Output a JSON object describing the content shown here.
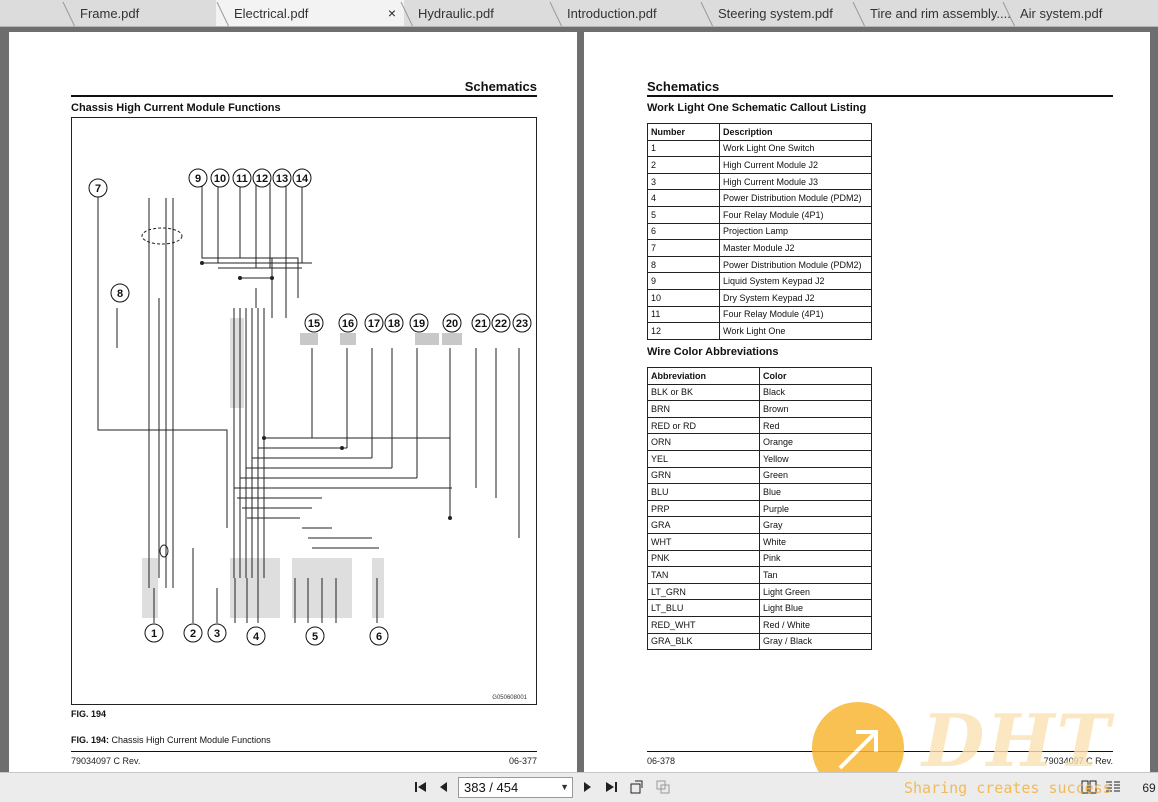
{
  "tabs": [
    {
      "label": "Frame.pdf",
      "active": false
    },
    {
      "label": "Electrical.pdf",
      "active": true,
      "close": "×"
    },
    {
      "label": "Hydraulic.pdf",
      "active": false
    },
    {
      "label": "Introduction.pdf",
      "active": false
    },
    {
      "label": "Steering system.pdf",
      "active": false
    },
    {
      "label": "Tire and rim assembly....",
      "active": false
    },
    {
      "label": "Air system.pdf",
      "active": false
    }
  ],
  "left_page": {
    "section": "Schematics",
    "subtitle": "Chassis High Current Module Functions",
    "fig_label": "FIG. 194",
    "caption_prefix": "FIG. 194:",
    "caption_text": "Chassis High Current Module Functions",
    "drawing_id": "G050608001",
    "footer_left": "79034097 C Rev.",
    "footer_right": "06-377",
    "callouts": [
      "1",
      "2",
      "3",
      "4",
      "5",
      "6",
      "7",
      "8",
      "9",
      "10",
      "11",
      "12",
      "13",
      "14",
      "15",
      "16",
      "17",
      "18",
      "19",
      "20",
      "21",
      "22",
      "23"
    ]
  },
  "right_page": {
    "section": "Schematics",
    "callout_title": "Work Light One Schematic Callout Listing",
    "callout_headers": [
      "Number",
      "Description"
    ],
    "callout_rows": [
      [
        "1",
        "Work Light One Switch"
      ],
      [
        "2",
        "High Current Module J2"
      ],
      [
        "3",
        "High Current Module J3"
      ],
      [
        "4",
        "Power Distribution Module (PDM2)"
      ],
      [
        "5",
        "Four Relay Module (4P1)"
      ],
      [
        "6",
        "Projection Lamp"
      ],
      [
        "7",
        "Master Module J2"
      ],
      [
        "8",
        "Power Distribution Module (PDM2)"
      ],
      [
        "9",
        "Liquid System Keypad J2"
      ],
      [
        "10",
        "Dry System Keypad J2"
      ],
      [
        "11",
        "Four Relay Module (4P1)"
      ],
      [
        "12",
        "Work Light One"
      ]
    ],
    "wire_title": "Wire Color Abbreviations",
    "wire_headers": [
      "Abbreviation",
      "Color"
    ],
    "wire_rows": [
      [
        "BLK or BK",
        "Black"
      ],
      [
        "BRN",
        "Brown"
      ],
      [
        "RED or RD",
        "Red"
      ],
      [
        "ORN",
        "Orange"
      ],
      [
        "YEL",
        "Yellow"
      ],
      [
        "GRN",
        "Green"
      ],
      [
        "BLU",
        "Blue"
      ],
      [
        "PRP",
        "Purple"
      ],
      [
        "GRA",
        "Gray"
      ],
      [
        "WHT",
        "White"
      ],
      [
        "PNK",
        "Pink"
      ],
      [
        "TAN",
        "Tan"
      ],
      [
        "LT_GRN",
        "Light Green"
      ],
      [
        "LT_BLU",
        "Light Blue"
      ],
      [
        "RED_WHT",
        "Red / White"
      ],
      [
        "GRA_BLK",
        "Gray / Black"
      ]
    ],
    "footer_left": "06-378",
    "footer_right": "79034097 C Rev."
  },
  "toolbar": {
    "page_value": "383 / 454",
    "zoom_suffix": "69"
  },
  "watermark": {
    "brand": "DHT",
    "tagline": "Sharing creates success"
  },
  "colors": {
    "viewer_bg": "#6e6e6e",
    "tabbar_bg": "#dcdcdc",
    "watermark_orange": "#f7b733"
  }
}
